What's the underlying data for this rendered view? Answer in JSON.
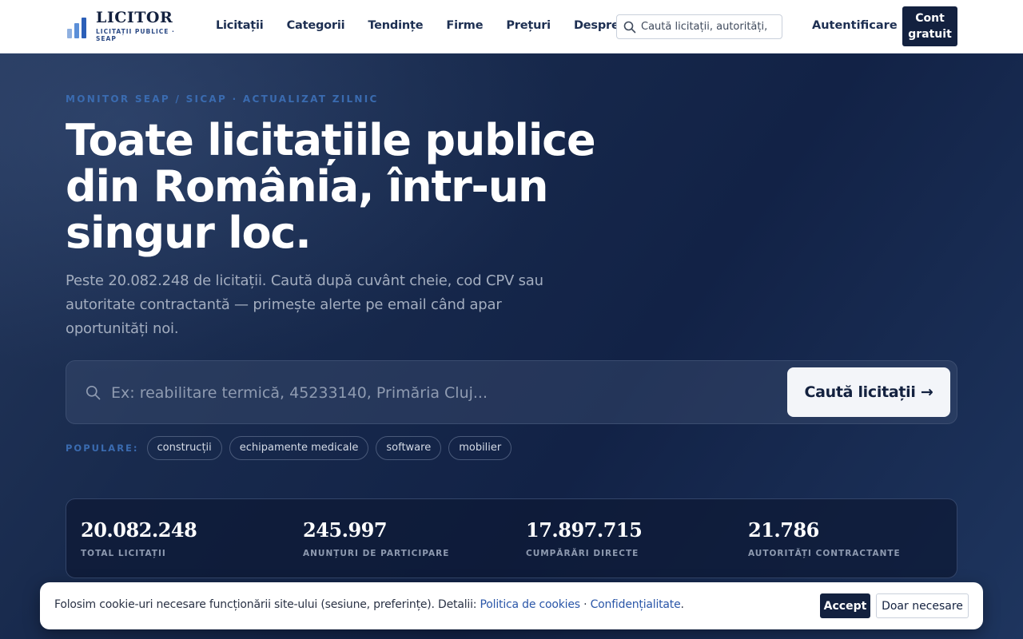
{
  "brand": {
    "name": "LICITOR",
    "tagline": "LICITAȚII PUBLICE · SEAP",
    "colors": {
      "navy": "#13213f",
      "accent_blue": "#3a6bb0",
      "light_blue": "#5b8fd8"
    }
  },
  "nav": {
    "items": [
      "Licitații",
      "Categorii",
      "Tendințe",
      "Firme",
      "Prețuri",
      "Despre"
    ]
  },
  "header_search": {
    "placeholder": "Caută licitații, autorități,"
  },
  "header_actions": {
    "login": "Autentificare",
    "signup": "Cont gratuit"
  },
  "hero": {
    "kicker": "MONITOR SEAP / SICAP · ACTUALIZAT ZILNIC",
    "title": "Toate licitațiile publice din România, într-un singur loc.",
    "subtitle": "Peste 20.082.248 de licitații. Caută după cuvânt cheie, cod CPV sau autoritate contractantă — primește alerte pe email când apar oportunități noi.",
    "search": {
      "placeholder": "Ex: reabilitare termică, 45233140, Primăria Cluj...",
      "button": "Caută licitații",
      "button_icon": "arrow-right-icon"
    },
    "popular": {
      "label": "POPULARE:",
      "chips": [
        "construcții",
        "echipamente medicale",
        "software",
        "mobilier"
      ]
    }
  },
  "stats": [
    {
      "value": "20.082.248",
      "label": "TOTAL LICITAȚII"
    },
    {
      "value": "245.997",
      "label": "ANUNȚURI DE PARTICIPARE"
    },
    {
      "value": "17.897.715",
      "label": "CUMPĂRĂRI DIRECTE"
    },
    {
      "value": "21.786",
      "label": "AUTORITĂȚI CONTRACTANTE"
    }
  ],
  "cookie": {
    "text": "Folosim cookie-uri necesare funcționării site-ului (sesiune, preferințe). Detalii: ",
    "link_cookies": "Politica de cookies",
    "separator": " · ",
    "link_privacy": "Confidențialitate",
    "end": ".",
    "accept": "Accept",
    "necessary": "Doar necesare"
  }
}
